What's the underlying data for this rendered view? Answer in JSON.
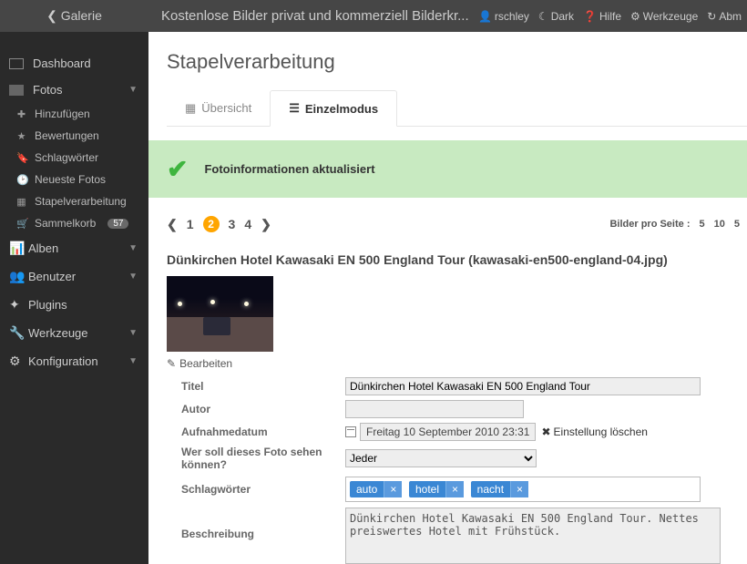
{
  "header": {
    "back": "Galerie",
    "title": "Kostenlose Bilder privat und kommerziell Bilderkr...",
    "user": "rschley",
    "dark": "Dark",
    "help": "Hilfe",
    "tools": "Werkzeuge",
    "logout": "Abm"
  },
  "sidebar": {
    "dashboard": "Dashboard",
    "fotos": "Fotos",
    "sub": {
      "add": "Hinzufügen",
      "ratings": "Bewertungen",
      "tags": "Schlagwörter",
      "newest": "Neueste Fotos",
      "batch": "Stapelverarbeitung",
      "basket": "Sammelkorb",
      "basket_count": "57"
    },
    "albums": "Alben",
    "users": "Benutzer",
    "plugins": "Plugins",
    "tools": "Werkzeuge",
    "config": "Konfiguration"
  },
  "page": {
    "title": "Stapelverarbeitung",
    "tabs": {
      "overview": "Übersicht",
      "single": "Einzelmodus"
    },
    "alert": "Fotoinformationen aktualisiert",
    "pages": {
      "p1": "1",
      "p2": "2",
      "p3": "3",
      "p4": "4"
    },
    "perpage": {
      "label": "Bilder pro Seite :",
      "a": "5",
      "b": "10",
      "c": "5"
    },
    "photo_title": "Dünkirchen Hotel Kawasaki EN 500 England Tour (kawasaki-en500-england-04.jpg)",
    "edit": "Bearbeiten",
    "form": {
      "title_lbl": "Titel",
      "title_val": "Dünkirchen Hotel Kawasaki EN 500 England Tour",
      "author_lbl": "Autor",
      "author_val": "",
      "date_lbl": "Aufnahmedatum",
      "date_val": "Freitag 10 September 2010 23:31",
      "delete_setting": "Einstellung löschen",
      "who_lbl": "Wer soll dieses Foto sehen können?",
      "who_val": "Jeder",
      "tags_lbl": "Schlagwörter",
      "tag1": "auto",
      "tag2": "hotel",
      "tag3": "nacht",
      "desc_lbl": "Beschreibung",
      "desc_val": "Dünkirchen Hotel Kawasaki EN 500 England Tour. Nettes preiswertes Hotel mit Frühstück."
    }
  }
}
